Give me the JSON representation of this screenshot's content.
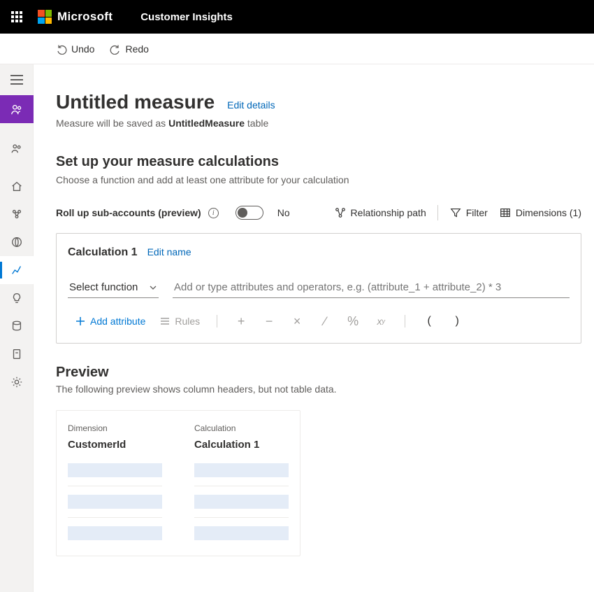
{
  "header": {
    "brand": "Microsoft",
    "app_name": "Customer Insights"
  },
  "commands": {
    "undo": "Undo",
    "redo": "Redo"
  },
  "page": {
    "title": "Untitled measure",
    "edit_details": "Edit details",
    "save_prefix": "Measure will be saved as ",
    "save_name": "UntitledMeasure",
    "save_suffix": " table"
  },
  "section": {
    "heading": "Set up your measure calculations",
    "description": "Choose a function and add at least one attribute for your calculation"
  },
  "rollup": {
    "label": "Roll up sub-accounts (preview)",
    "state": "No"
  },
  "options": {
    "relationship_path": "Relationship path",
    "filter": "Filter",
    "dimensions": "Dimensions (1)"
  },
  "calculation": {
    "name": "Calculation 1",
    "edit_name": "Edit name",
    "select_function": "Select function",
    "attr_placeholder": "Add or type attributes and operators, e.g. (attribute_1 + attribute_2) * 3",
    "add_attribute": "Add attribute",
    "rules": "Rules"
  },
  "preview": {
    "heading": "Preview",
    "description": "The following preview shows column headers, but not table data.",
    "columns": [
      {
        "label": "Dimension",
        "value": "CustomerId"
      },
      {
        "label": "Calculation",
        "value": "Calculation 1"
      }
    ]
  }
}
